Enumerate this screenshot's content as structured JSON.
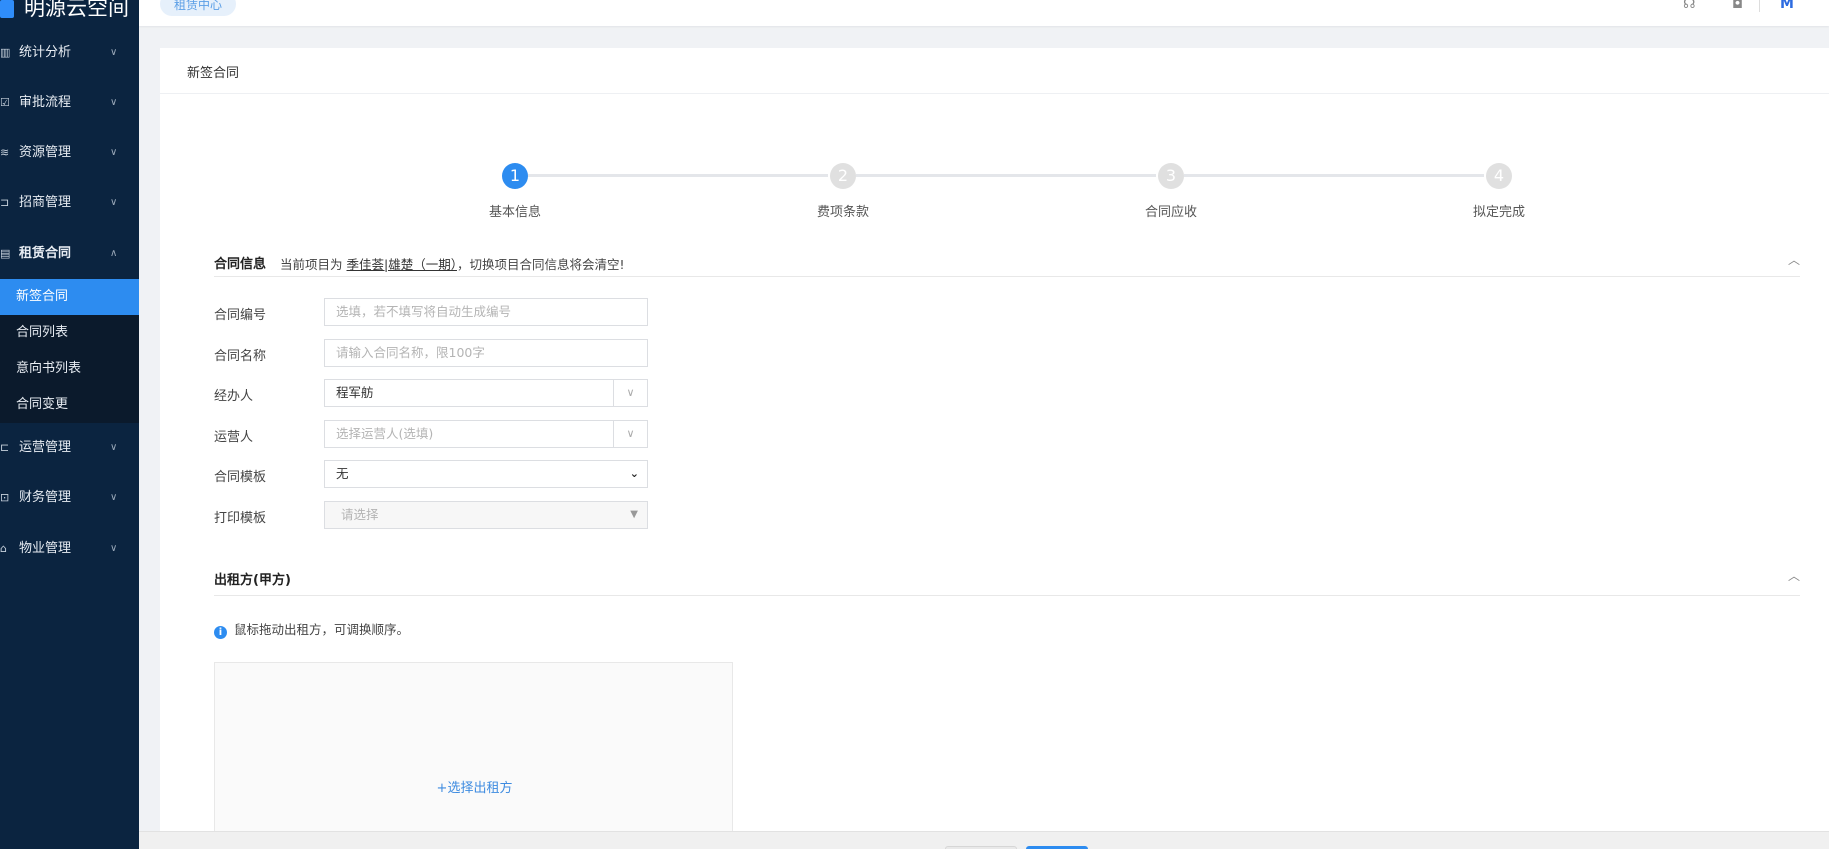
{
  "app": {
    "logo_text": "明源云空间"
  },
  "header": {
    "breadcrumb_tag": "租赁中心",
    "icons": [
      "headset-icon",
      "bell-icon",
      "brand-icon"
    ]
  },
  "sidebar": {
    "items": [
      {
        "icon": "chart-icon",
        "label": "统计分析",
        "expanded": false
      },
      {
        "icon": "approve-icon",
        "label": "审批流程",
        "expanded": false
      },
      {
        "icon": "layers-icon",
        "label": "资源管理",
        "expanded": false
      },
      {
        "icon": "flag-icon",
        "label": "招商管理",
        "expanded": false
      },
      {
        "icon": "contract-icon",
        "label": "租赁合同",
        "expanded": true,
        "children": [
          {
            "label": "新签合同",
            "active": true
          },
          {
            "label": "合同列表",
            "active": false
          },
          {
            "label": "意向书列表",
            "active": false
          },
          {
            "label": "合同变更",
            "active": false
          }
        ]
      },
      {
        "icon": "operate-icon",
        "label": "运营管理",
        "expanded": false
      },
      {
        "icon": "finance-icon",
        "label": "财务管理",
        "expanded": false
      },
      {
        "icon": "building-icon",
        "label": "物业管理",
        "expanded": false
      }
    ]
  },
  "page": {
    "title": "新签合同"
  },
  "steps": [
    {
      "number": "1",
      "label": "基本信息",
      "active": true
    },
    {
      "number": "2",
      "label": "费项条款",
      "active": false
    },
    {
      "number": "3",
      "label": "合同应收",
      "active": false
    },
    {
      "number": "4",
      "label": "拟定完成",
      "active": false
    }
  ],
  "contract_info": {
    "title": "合同信息",
    "note_prefix": "当前项目为",
    "project_name": "季佳荟|雄楚（一期）",
    "note_suffix": "，切换项目合同信息将会清空!",
    "fields": {
      "number": {
        "label": "合同编号",
        "placeholder": "选填，若不填写将自动生成编号"
      },
      "name": {
        "label": "合同名称",
        "placeholder": "请输入合同名称，限100字"
      },
      "handler": {
        "label": "经办人",
        "value": "程军舫"
      },
      "operator": {
        "label": "运营人",
        "placeholder": "选择运营人(选填)"
      },
      "template": {
        "label": "合同模板",
        "value": "无"
      },
      "print_template": {
        "label": "打印模板",
        "placeholder": "请选择"
      }
    }
  },
  "lessor": {
    "title": "出租方(甲方)",
    "tip": "鼠标拖动出租方，可调换顺序。",
    "add_link": "+选择出租方"
  },
  "colors": {
    "primary": "#2d8cf0",
    "sidebar": "#0b2440",
    "step_inactive": "#e0e0e0"
  }
}
